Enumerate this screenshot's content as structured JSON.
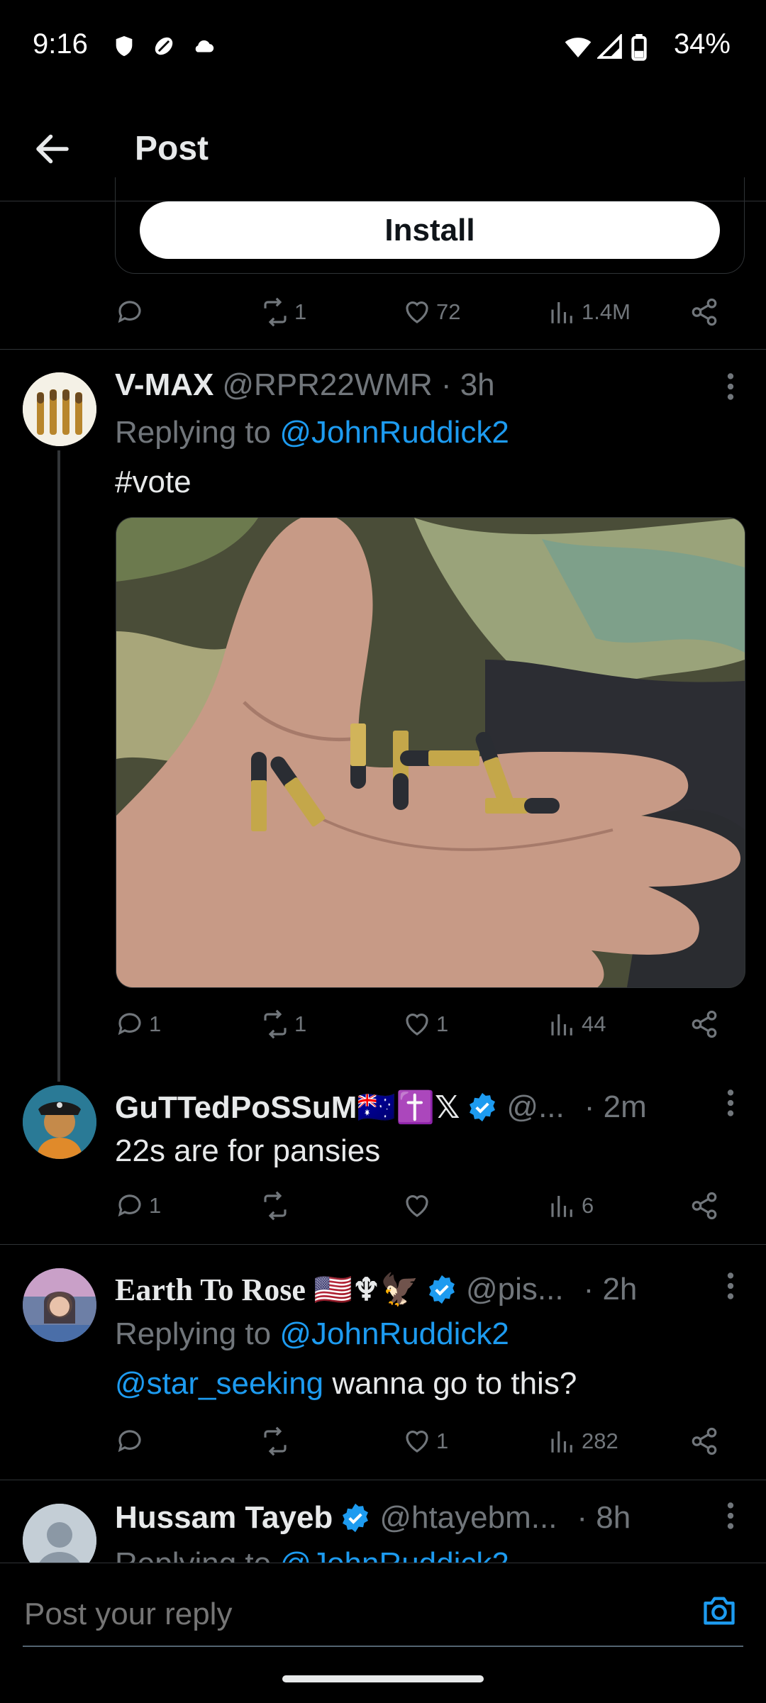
{
  "status": {
    "time": "9:16",
    "battery": "34%"
  },
  "header": {
    "title": "Post"
  },
  "ad": {
    "install_label": "Install",
    "retweets": "1",
    "likes": "72",
    "views": "1.4M"
  },
  "posts": [
    {
      "name": "V-MAX",
      "handle": "@RPR22WMR",
      "time": "· 3h",
      "replying_prefix": "Replying to ",
      "replying_to": "@JohnRuddick2",
      "hashtag": "#vote",
      "replies": "1",
      "retweets": "1",
      "likes": "1",
      "views": "44"
    },
    {
      "name": "GuTTedPoSSuM🇦🇺✝️𝕏",
      "handle": "@...",
      "time": "· 2m",
      "text": "22s are for pansies",
      "replies": "1",
      "retweets": "",
      "likes": "",
      "views": "6"
    },
    {
      "name": "Earth To Rose 🇺🇸♆🦅",
      "handle": "@pis...",
      "time": "· 2h",
      "replying_prefix": "Replying to ",
      "replying_to": "@JohnRuddick2",
      "mention": "@star_seeking",
      "text": " wanna go to this?",
      "replies": "",
      "retweets": "",
      "likes": "1",
      "views": "282"
    },
    {
      "name": "Hussam Tayeb",
      "handle": "@htayebm...",
      "time": "· 8h",
      "replying_prefix": "Replying to ",
      "replying_to": "@JohnRuddick2"
    }
  ],
  "composer": {
    "placeholder": "Post your reply"
  },
  "colors": {
    "accent": "#1d9bf0",
    "background": "#000000",
    "muted": "#71767b"
  }
}
